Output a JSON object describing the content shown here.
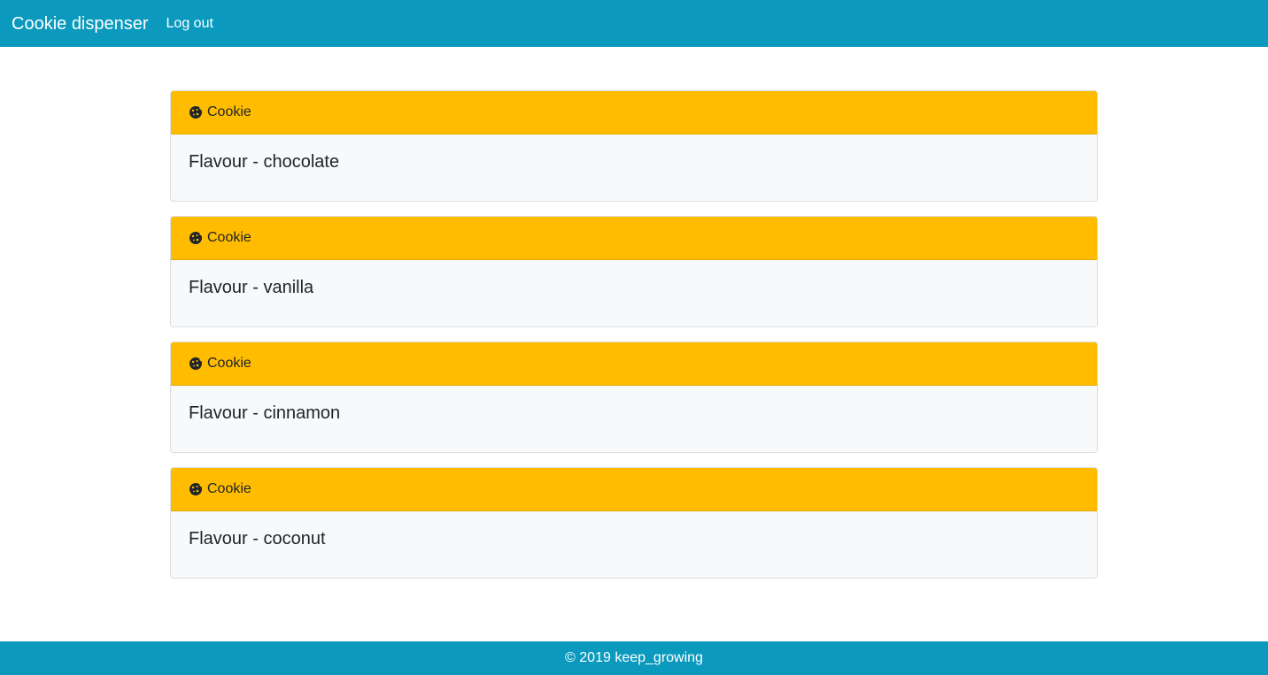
{
  "navbar": {
    "brand": "Cookie dispenser",
    "links": [
      {
        "label": "Log out"
      }
    ]
  },
  "cards": [
    {
      "header": "Cookie",
      "icon": "cookie-icon",
      "text": "Flavour - chocolate"
    },
    {
      "header": "Cookie",
      "icon": "cookie-icon",
      "text": "Flavour - vanilla"
    },
    {
      "header": "Cookie",
      "icon": "cookie-icon",
      "text": "Flavour - cinnamon"
    },
    {
      "header": "Cookie",
      "icon": "cookie-icon",
      "text": "Flavour - coconut"
    }
  ],
  "footer": {
    "text": "© 2019 keep_growing"
  },
  "colors": {
    "navbar": "#0b9abe",
    "card_header": "#ffbc00",
    "card_body": "#f8f9fa"
  }
}
